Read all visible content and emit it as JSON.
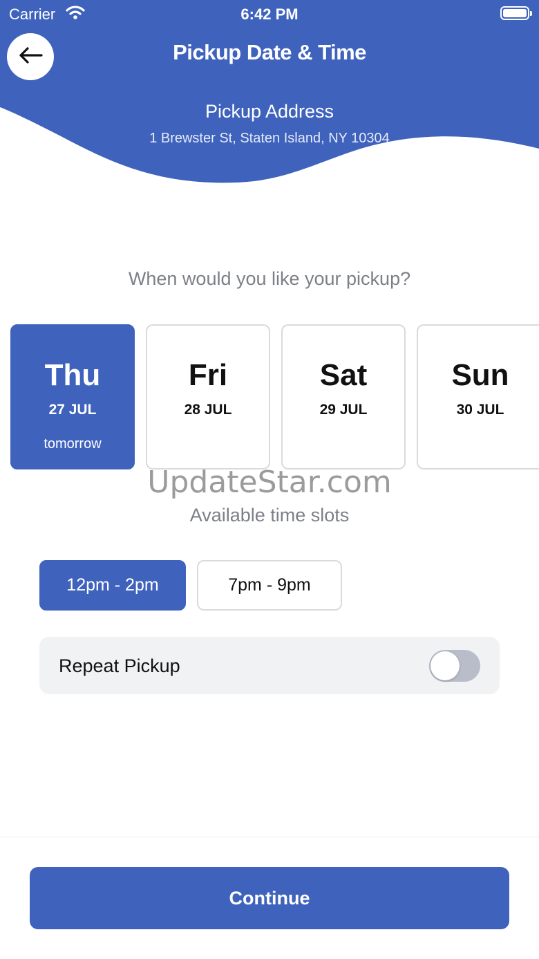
{
  "status_bar": {
    "carrier": "Carrier",
    "time": "6:42 PM"
  },
  "header": {
    "title": "Pickup Date & Time",
    "address_label": "Pickup Address",
    "address_value": "1 Brewster St, Staten Island, NY 10304",
    "back_icon": "arrow-left-icon"
  },
  "date_picker": {
    "question": "When would you like your pickup?",
    "days": [
      {
        "day": "Thu",
        "date": "27 JUL",
        "sub": "tomorrow",
        "selected": true
      },
      {
        "day": "Fri",
        "date": "28 JUL",
        "sub": "",
        "selected": false
      },
      {
        "day": "Sat",
        "date": "29 JUL",
        "sub": "",
        "selected": false
      },
      {
        "day": "Sun",
        "date": "30 JUL",
        "sub": "",
        "selected": false
      }
    ]
  },
  "watermark": "UpdateStar.com",
  "time_slots": {
    "heading": "Available time slots",
    "slots": [
      {
        "label": "12pm - 2pm",
        "selected": true
      },
      {
        "label": "7pm - 9pm",
        "selected": false
      }
    ]
  },
  "repeat": {
    "label": "Repeat Pickup",
    "enabled": false
  },
  "footer": {
    "continue_label": "Continue"
  },
  "colors": {
    "accent": "#3f63bd",
    "card_border": "#d9dadd",
    "muted_text": "#7c7f86",
    "toggle_off": "#b9bdc9",
    "row_bg": "#f1f2f4"
  }
}
